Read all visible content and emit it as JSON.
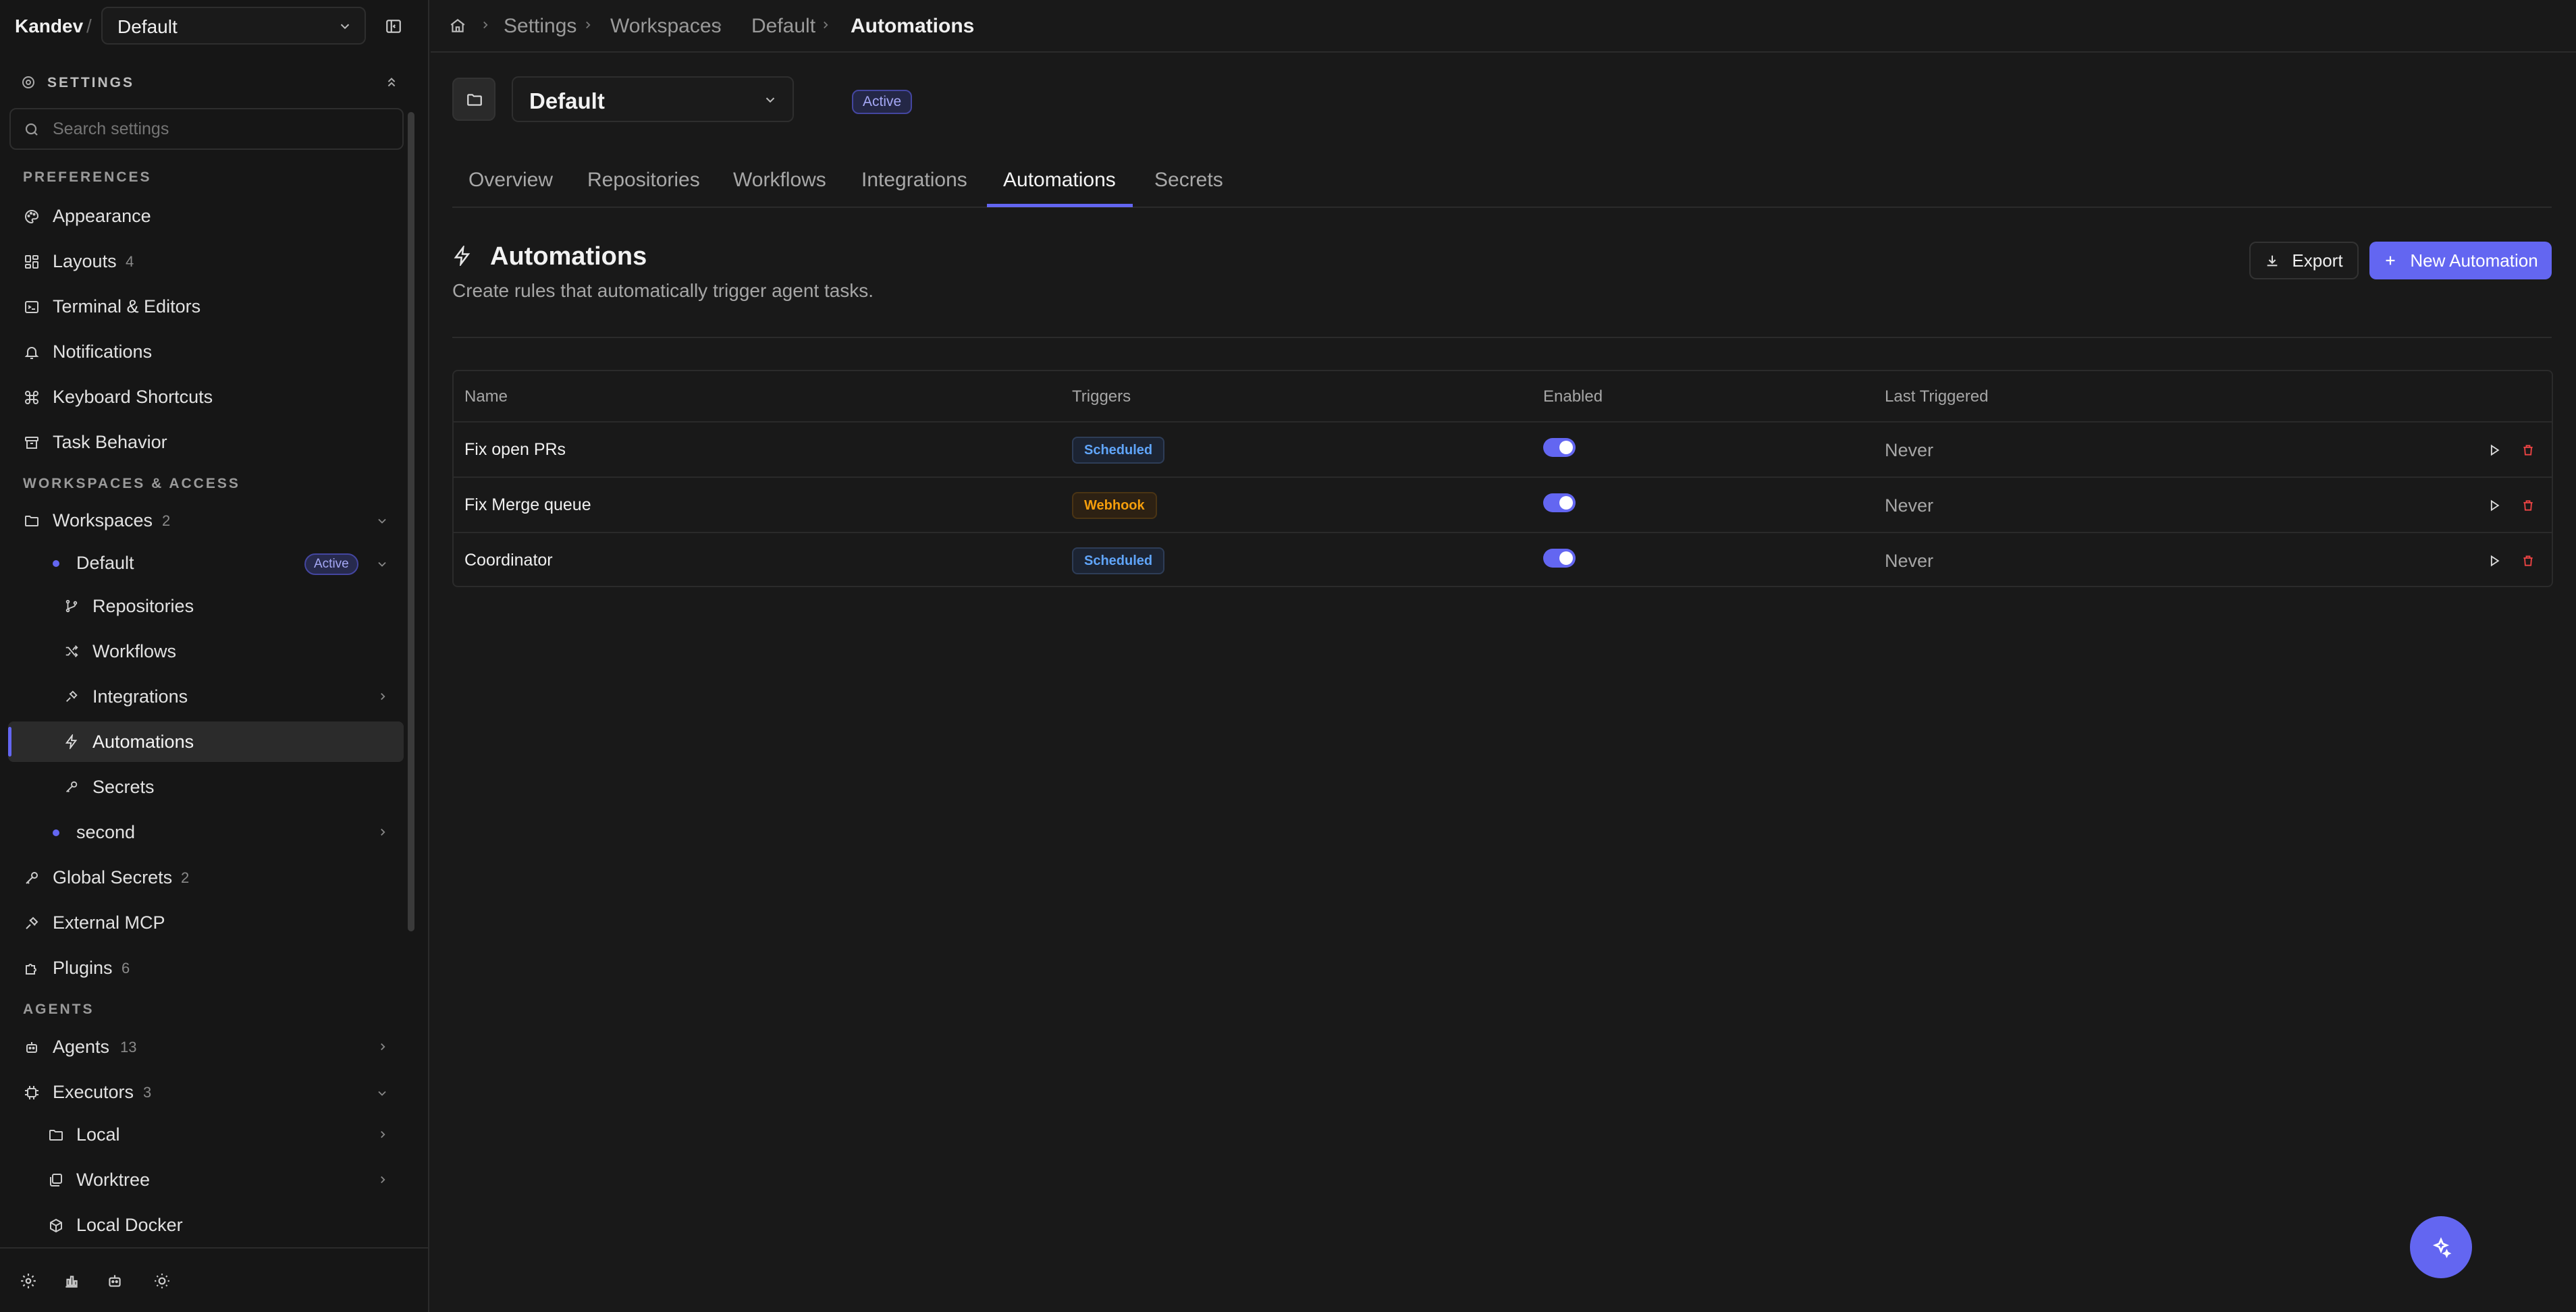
{
  "app": {
    "brand": "Kandev",
    "separator": "/",
    "workspace_select": "Default"
  },
  "sidebar": {
    "header": "SETTINGS",
    "search_placeholder": "Search settings",
    "sections": {
      "preferences": "PREFERENCES",
      "workspaces": "WORKSPACES & ACCESS",
      "agents": "AGENTS"
    },
    "preferences": [
      {
        "label": "Appearance",
        "icon": "palette-icon"
      },
      {
        "label": "Layouts",
        "count": "4",
        "icon": "layout-icon"
      },
      {
        "label": "Terminal & Editors",
        "icon": "terminal-icon"
      },
      {
        "label": "Notifications",
        "icon": "bell-icon"
      },
      {
        "label": "Keyboard Shortcuts",
        "icon": "command-icon"
      },
      {
        "label": "Task Behavior",
        "icon": "archive-icon"
      }
    ],
    "workspaces": {
      "label": "Workspaces",
      "count": "2",
      "default": {
        "label": "Default",
        "badge": "Active"
      },
      "children": [
        {
          "label": "Repositories",
          "icon": "git-branch-icon"
        },
        {
          "label": "Workflows",
          "icon": "shuffle-icon"
        },
        {
          "label": "Integrations",
          "icon": "plug-icon"
        },
        {
          "label": "Automations",
          "icon": "zap-icon"
        },
        {
          "label": "Secrets",
          "icon": "key-icon"
        }
      ],
      "second": {
        "label": "second"
      }
    },
    "access": [
      {
        "label": "Global Secrets",
        "count": "2",
        "icon": "key-icon"
      },
      {
        "label": "External MCP",
        "icon": "plug-icon"
      },
      {
        "label": "Plugins",
        "count": "6",
        "icon": "puzzle-icon"
      }
    ],
    "agents": [
      {
        "label": "Agents",
        "count": "13",
        "icon": "bot-icon"
      },
      {
        "label": "Executors",
        "count": "3",
        "icon": "cpu-icon"
      }
    ],
    "executors": [
      {
        "label": "Local",
        "icon": "folder-icon"
      },
      {
        "label": "Worktree",
        "icon": "layers-icon"
      },
      {
        "label": "Local Docker",
        "icon": "box-icon"
      }
    ]
  },
  "breadcrumb": [
    "Settings",
    "Workspaces",
    "Default",
    "Automations"
  ],
  "workspace_header": {
    "name": "Default",
    "status": "Active"
  },
  "tabs": [
    "Overview",
    "Repositories",
    "Workflows",
    "Integrations",
    "Automations",
    "Secrets"
  ],
  "active_tab": "Automations",
  "page": {
    "title": "Automations",
    "description": "Create rules that automatically trigger agent tasks.",
    "export_label": "Export",
    "new_label": "New Automation"
  },
  "table": {
    "headers": [
      "Name",
      "Triggers",
      "Enabled",
      "Last Triggered"
    ],
    "rows": [
      {
        "name": "Fix open PRs",
        "trigger": "Scheduled",
        "enabled": true,
        "last": "Never"
      },
      {
        "name": "Fix Merge queue",
        "trigger": "Webhook",
        "enabled": true,
        "last": "Never"
      },
      {
        "name": "Coordinator",
        "trigger": "Scheduled",
        "enabled": true,
        "last": "Never"
      }
    ]
  },
  "colors": {
    "accent": "#6366f1",
    "scheduled": "#60a5fa",
    "webhook": "#f59e0b",
    "delete": "#ef4444"
  }
}
